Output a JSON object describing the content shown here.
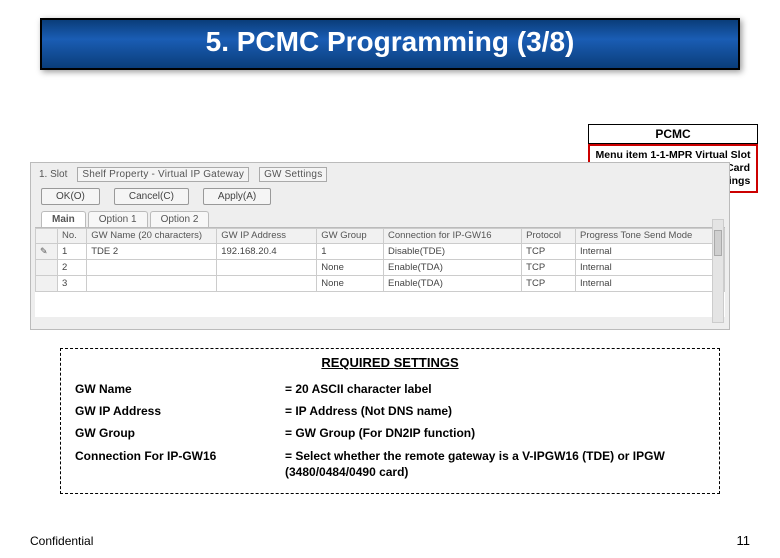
{
  "slide": {
    "title": "5. PCMC Programming (3/8)",
    "confidential": "Confidential",
    "page_number": "11"
  },
  "callout": {
    "heading": "PCMC",
    "body": "Menu item 1-1-MPR Virtual Slot - Select Shelf – V-IPGW16 Card – Shelf Property – GW Settings"
  },
  "dialog": {
    "slot_label": "1.  Slot",
    "card_label": "Shelf Property - Virtual IP Gateway",
    "gw_settings_tab": "GW Settings",
    "buttons": {
      "ok": "OK(O)",
      "cancel": "Cancel(C)",
      "apply": "Apply(A)"
    },
    "tabs": {
      "main": "Main",
      "opt1": "Option 1",
      "opt2": "Option 2"
    },
    "columns": {
      "no": "No.",
      "gw_name": "GW Name\n(20 characters)",
      "gw_ip": "GW IP Address",
      "gw_group": "GW Group",
      "conn": "Connection\nfor IP-GW16",
      "proto": "Protocol",
      "tone": "Progress Tone\nSend Mode"
    },
    "rows": [
      {
        "no": "1",
        "gw_name": "TDE 2",
        "gw_ip": "192.168.20.4",
        "gw_group": "1",
        "conn": "Disable(TDE)",
        "proto": "TCP",
        "tone": "Internal"
      },
      {
        "no": "2",
        "gw_name": "",
        "gw_ip": "",
        "gw_group": "None",
        "conn": "Enable(TDA)",
        "proto": "TCP",
        "tone": "Internal"
      },
      {
        "no": "3",
        "gw_name": "",
        "gw_ip": "",
        "gw_group": "None",
        "conn": "Enable(TDA)",
        "proto": "TCP",
        "tone": "Internal"
      }
    ]
  },
  "required": {
    "title": "REQUIRED SETTINGS",
    "rows": [
      {
        "k": "GW Name",
        "v": "= 20 ASCII character label"
      },
      {
        "k": "GW IP Address",
        "v": "= IP Address (Not DNS name)"
      },
      {
        "k": "GW Group",
        "v": "= GW Group (For DN2IP function)"
      },
      {
        "k": "Connection For IP-GW16",
        "v": "= Select whether the remote gateway is a V-IPGW16 (TDE) or IPGW (3480/0484/0490 card)"
      }
    ]
  }
}
